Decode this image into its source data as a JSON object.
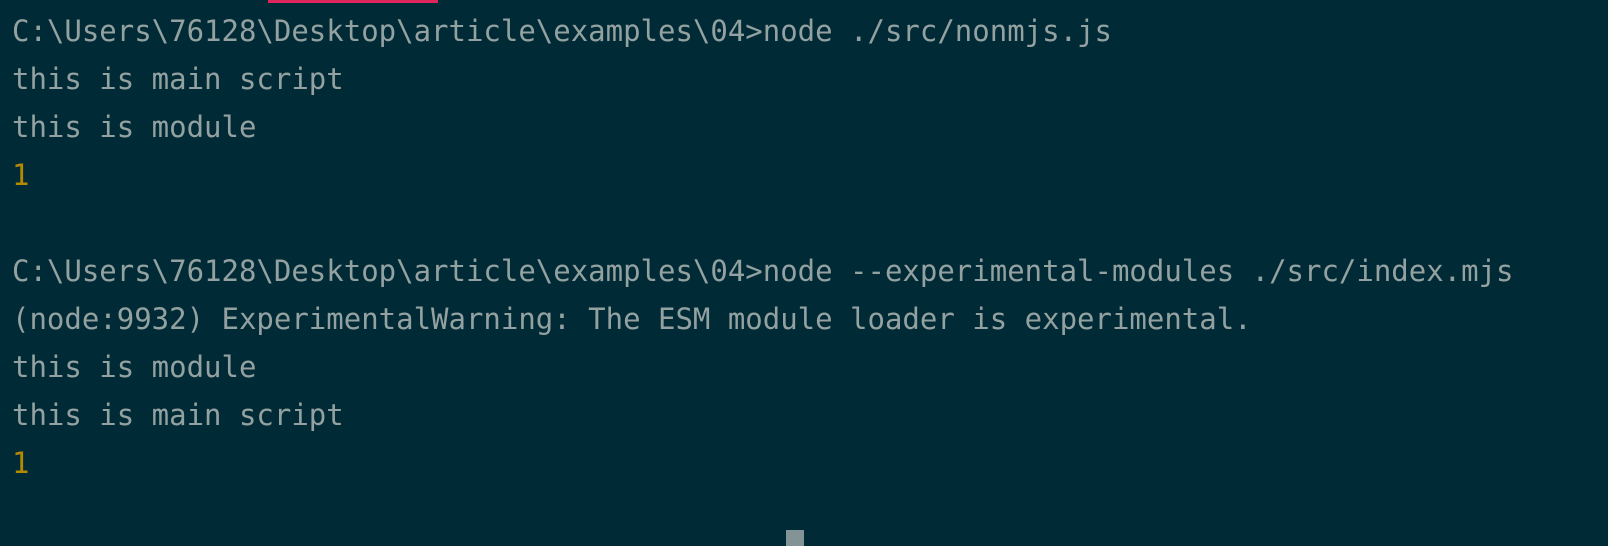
{
  "colors": {
    "background": "#002b36",
    "text": "#93a1a1",
    "number": "#b58900",
    "tab_accent": "#e0245e",
    "cursor": "#839496"
  },
  "lines": [
    {
      "text": "C:\\Users\\76128\\Desktop\\article\\examples\\04>node ./src/nonmjs.js"
    },
    {
      "text": "this is main script"
    },
    {
      "text": "this is module"
    },
    {
      "text": "1"
    },
    {
      "text": ""
    },
    {
      "text": "C:\\Users\\76128\\Desktop\\article\\examples\\04>node --experimental-modules ./src/index.mjs"
    },
    {
      "text": "(node:9932) ExperimentalWarning: The ESM module loader is experimental."
    },
    {
      "text": "this is module"
    },
    {
      "text": "this is main script"
    },
    {
      "text": "1"
    }
  ]
}
